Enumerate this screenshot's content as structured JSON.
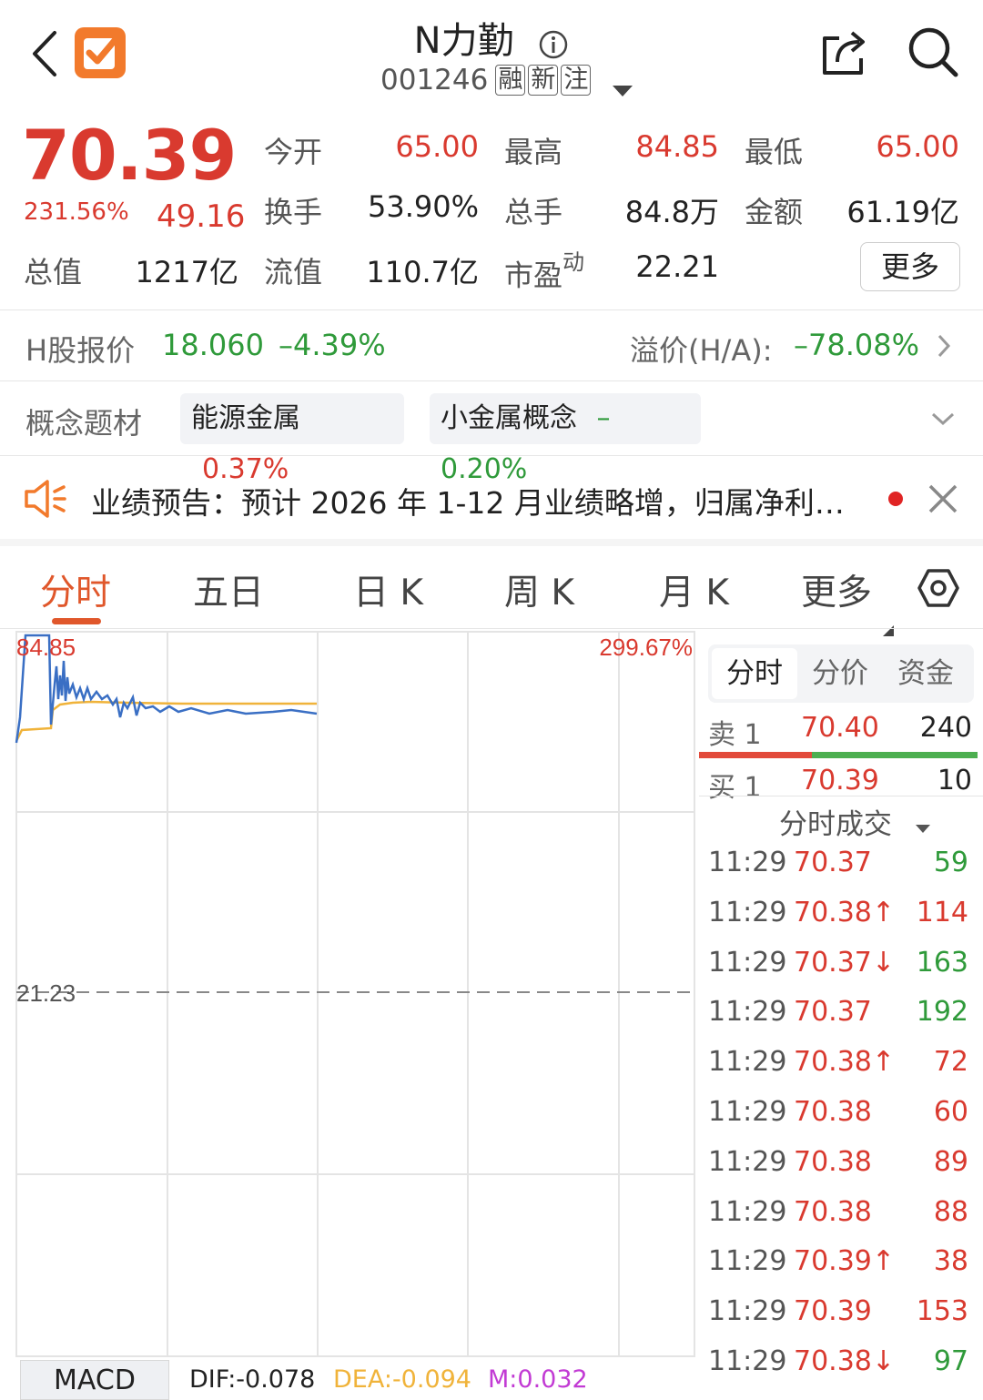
{
  "header": {
    "title": "N力勤",
    "code": "001246",
    "tags": [
      "融",
      "新",
      "注"
    ]
  },
  "quote": {
    "price": "70.39",
    "change_pct": "231.56%",
    "change": "49.16",
    "stats": [
      {
        "label": "今开",
        "value": "65.00",
        "color": "red"
      },
      {
        "label": "最高",
        "value": "84.85",
        "color": "red"
      },
      {
        "label": "最低",
        "value": "65.00",
        "color": "red"
      },
      {
        "label": "换手",
        "value": "53.90%",
        "color": "dark"
      },
      {
        "label": "总手",
        "value": "84.8万",
        "color": "dark"
      },
      {
        "label": "金额",
        "value": "61.19亿",
        "color": "dark"
      },
      {
        "label": "总值",
        "value": "1217亿",
        "color": "dark"
      },
      {
        "label": "流值",
        "value": "110.7亿",
        "color": "dark"
      },
      {
        "label": "市盈",
        "value": "22.21",
        "color": "dark"
      }
    ],
    "pe_superscript": "动",
    "more_label": "更多"
  },
  "hshare": {
    "label": "H股报价",
    "price": "18.060",
    "pct": "–4.39%",
    "premium_label": "溢价(H/A):",
    "premium_value": "–78.08%"
  },
  "concepts": {
    "label": "概念题材",
    "items": [
      {
        "name": "能源金属",
        "pct": "0.37%",
        "color": "red"
      },
      {
        "name": "小金属概念",
        "pct": "–0.20%",
        "color": "green"
      }
    ]
  },
  "notice": {
    "text": "业绩预告：预计 2026 年 1-12 月业绩略增，归属净利…"
  },
  "tabs": [
    "分时",
    "五日",
    "日 K",
    "周 K",
    "月 K",
    "更多"
  ],
  "chart": {
    "high_label": "84.85",
    "pct_label": "299.67%",
    "mid_label": "21.23"
  },
  "side": {
    "tabs": [
      "分时",
      "分价",
      "资金"
    ],
    "sell": {
      "label": "卖 1",
      "price": "70.40",
      "vol": "240"
    },
    "buy": {
      "label": "买 1",
      "price": "70.39",
      "vol": "10"
    },
    "trades_title": "分时成交",
    "trades": [
      {
        "time": "11:29",
        "price": "70.37",
        "vol": "59",
        "vcolor": "green"
      },
      {
        "time": "11:29",
        "price": "70.38↑",
        "vol": "114",
        "vcolor": "red"
      },
      {
        "time": "11:29",
        "price": "70.37↓",
        "vol": "163",
        "vcolor": "green"
      },
      {
        "time": "11:29",
        "price": "70.37",
        "vol": "192",
        "vcolor": "green"
      },
      {
        "time": "11:29",
        "price": "70.38↑",
        "vol": "72",
        "vcolor": "red"
      },
      {
        "time": "11:29",
        "price": "70.38",
        "vol": "60",
        "vcolor": "red"
      },
      {
        "time": "11:29",
        "price": "70.38",
        "vol": "89",
        "vcolor": "red"
      },
      {
        "time": "11:29",
        "price": "70.38",
        "vol": "88",
        "vcolor": "red"
      },
      {
        "time": "11:29",
        "price": "70.39↑",
        "vol": "38",
        "vcolor": "red"
      },
      {
        "time": "11:29",
        "price": "70.39",
        "vol": "153",
        "vcolor": "red"
      },
      {
        "time": "11:29",
        "price": "70.38↓",
        "vol": "97",
        "vcolor": "green"
      }
    ]
  },
  "macd": {
    "label": "MACD",
    "dif": "DIF:-0.078",
    "dea": "DEA:-0.094",
    "m": "M:0.032"
  },
  "colors": {
    "up": "#d93a2f",
    "down": "#2f9a3a",
    "accent": "#e0572b",
    "price_line": "#3a6fc4",
    "avg_line": "#f0b33a"
  }
}
